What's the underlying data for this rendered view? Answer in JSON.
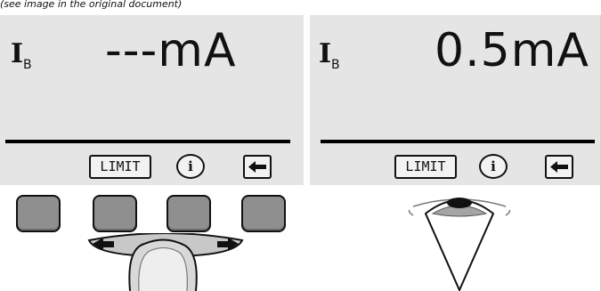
{
  "header": {
    "caption": "(see image in the original document)"
  },
  "left_display": {
    "symbol": "I",
    "symbol_sub": "B",
    "value": "---mA",
    "softkeys": {
      "limit_label": "LIMIT",
      "info_label": "i"
    }
  },
  "right_display": {
    "symbol": "I",
    "symbol_sub": "B",
    "value": "0.5mA",
    "softkeys": {
      "limit_label": "LIMIT",
      "info_label": "i"
    }
  },
  "colors": {
    "lcd_background": "#e5e5e5",
    "button_gray": "#8f8f8f",
    "selector_gray": "#c8c8c8",
    "text": "#111111"
  },
  "icons": [
    "back-arrow-icon",
    "info-icon",
    "left-arrow-icon",
    "right-arrow-icon",
    "rotary-knob-icon",
    "pointer-knob-icon"
  ]
}
